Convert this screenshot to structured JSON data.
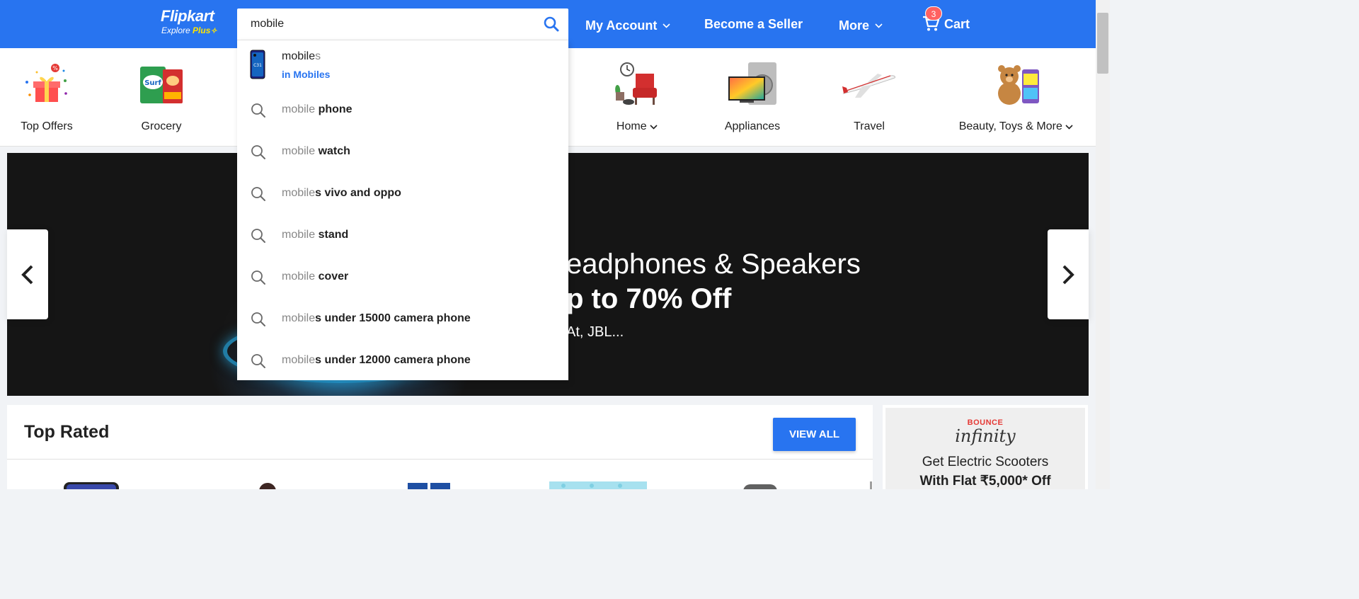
{
  "header": {
    "logo_brand": "Flipkart",
    "logo_tag_prefix": "Explore",
    "logo_tag_plus": "Plus",
    "nav": {
      "account": "My Account",
      "seller": "Become a Seller",
      "more": "More",
      "cart": "Cart",
      "cart_count": "3"
    },
    "colors": {
      "primary": "#2874f0",
      "accent": "#ffe500",
      "badge": "#ff6161"
    }
  },
  "search": {
    "value": "mobile",
    "placeholder": "",
    "suggestions": [
      {
        "typed": "mobile",
        "rest": "s",
        "category": "in Mobiles",
        "icon": "phone-thumbnail"
      },
      {
        "typed": "mobile",
        "rest": " phone",
        "icon": "search-icon"
      },
      {
        "typed": "mobile",
        "rest": " watch",
        "icon": "search-icon"
      },
      {
        "typed": "mobile",
        "rest": "s vivo and oppo",
        "icon": "search-icon"
      },
      {
        "typed": "mobile",
        "rest": " stand",
        "icon": "search-icon"
      },
      {
        "typed": "mobile",
        "rest": " cover",
        "icon": "search-icon"
      },
      {
        "typed": "mobile",
        "rest": "s under 15000 camera phone",
        "icon": "search-icon"
      },
      {
        "typed": "mobile",
        "rest": "s under 12000 camera phone",
        "icon": "search-icon"
      }
    ]
  },
  "categories": [
    {
      "label": "Top Offers",
      "icon": "gift-icon"
    },
    {
      "label": "Grocery",
      "icon": "grocery-icon"
    },
    {
      "label": "Home",
      "icon": "home-furniture-icon"
    },
    {
      "label": "Appliances",
      "icon": "appliances-icon"
    },
    {
      "label": "Travel",
      "icon": "airplane-icon"
    },
    {
      "label": "Beauty, Toys & More",
      "icon": "teddy-bear-icon"
    }
  ],
  "banner": {
    "line1": "eadphones & Speakers",
    "line2": "p to 70% Off",
    "line3": "At, JBL..."
  },
  "top_rated": {
    "title": "Top Rated",
    "view_all": "VIEW ALL"
  },
  "ad": {
    "brand": "BOUNCE",
    "logo_text": "infinity",
    "line1": "Get Electric Scooters",
    "line2": "With Flat ₹5,000* Off"
  }
}
